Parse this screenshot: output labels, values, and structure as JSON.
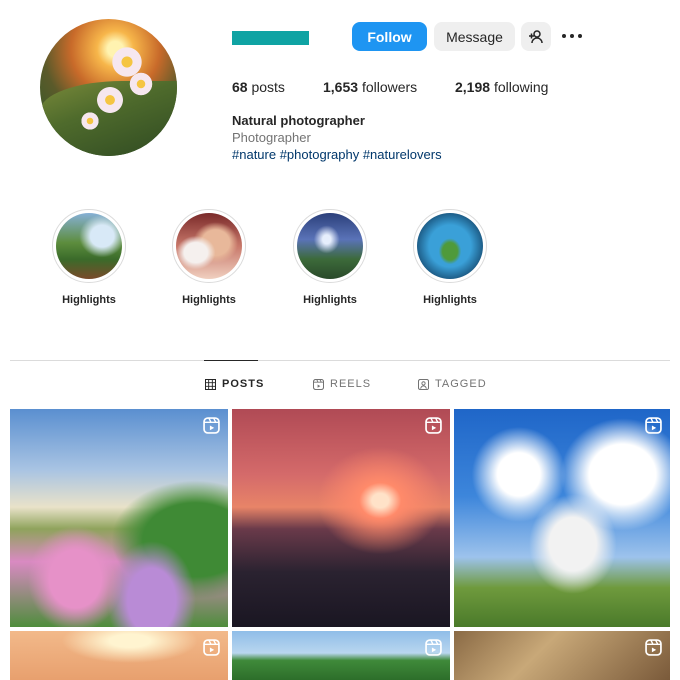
{
  "profile": {
    "follow_label": "Follow",
    "message_label": "Message",
    "stats": {
      "posts": {
        "num": "68",
        "label": "posts"
      },
      "followers": {
        "num": "1,653",
        "label": "followers"
      },
      "following": {
        "num": "2,198",
        "label": "following"
      }
    },
    "bio": {
      "name": "Natural photographer",
      "category": "Photographer",
      "tags": "#nature #photography #naturelovers"
    }
  },
  "highlights": [
    {
      "label": "Highlights"
    },
    {
      "label": "Highlights"
    },
    {
      "label": "Highlights"
    },
    {
      "label": "Highlights"
    }
  ],
  "tabs": {
    "posts": "POSTS",
    "reels": "REELS",
    "tagged": "TAGGED"
  },
  "colors": {
    "accent": "#1e95f2",
    "username_redaction": "#0fa3a3",
    "hashtag": "#00376b"
  },
  "icons": {
    "add_user": "add-person-icon",
    "more": "more-options-icon",
    "posts_tab": "grid-icon",
    "reels_tab": "reels-icon",
    "tagged_tab": "tagged-icon",
    "post_badge": "reel-badge-icon"
  }
}
